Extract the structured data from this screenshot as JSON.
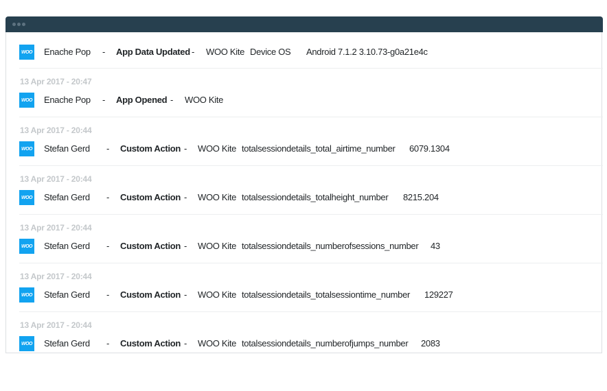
{
  "window": {
    "titlebar_dots": 3
  },
  "feed": {
    "entries": [
      {
        "timestamp": "",
        "app_icon": "woo-logo-icon",
        "app_icon_text": "WOO",
        "user": "Enache Pop",
        "separator1": "-",
        "event": "App Data Updated",
        "separator2": "-",
        "app": "WOO Kite",
        "property": "Device OS",
        "value": "Android 7.1.2 3.10.73-g0a21e4c"
      },
      {
        "timestamp": "13 Apr 2017 - 20:47",
        "app_icon": "woo-logo-icon",
        "app_icon_text": "WOO",
        "user": "Enache Pop",
        "separator1": "-",
        "event": "App Opened",
        "separator2": "-",
        "app": "WOO Kite",
        "property": "",
        "value": ""
      },
      {
        "timestamp": "13 Apr 2017 - 20:44",
        "app_icon": "woo-logo-icon",
        "app_icon_text": "WOO",
        "user": "Stefan Gerd",
        "separator1": "-",
        "event": "Custom Action",
        "separator2": "-",
        "app": "WOO Kite",
        "property": "totalsessiondetails_total_airtime_number",
        "value": "6079.1304"
      },
      {
        "timestamp": "13 Apr 2017 - 20:44",
        "app_icon": "woo-logo-icon",
        "app_icon_text": "WOO",
        "user": "Stefan Gerd",
        "separator1": "-",
        "event": "Custom Action",
        "separator2": "-",
        "app": "WOO Kite",
        "property": "totalsessiondetails_totalheight_number",
        "value": "8215.204"
      },
      {
        "timestamp": "13 Apr 2017 - 20:44",
        "app_icon": "woo-logo-icon",
        "app_icon_text": "WOO",
        "user": "Stefan Gerd",
        "separator1": "-",
        "event": "Custom Action",
        "separator2": "-",
        "app": "WOO Kite",
        "property": "totalsessiondetails_numberofsessions_number",
        "value": "43"
      },
      {
        "timestamp": "13 Apr 2017 - 20:44",
        "app_icon": "woo-logo-icon",
        "app_icon_text": "WOO",
        "user": "Stefan Gerd",
        "separator1": "-",
        "event": "Custom Action",
        "separator2": "-",
        "app": "WOO Kite",
        "property": "totalsessiondetails_totalsessiontime_number",
        "value": "129227"
      },
      {
        "timestamp": "13 Apr 2017 - 20:44",
        "app_icon": "woo-logo-icon",
        "app_icon_text": "WOO",
        "user": "Stefan Gerd",
        "separator1": "-",
        "event": "Custom Action",
        "separator2": "-",
        "app": "WOO Kite",
        "property": "totalsessiondetails_numberofjumps_number",
        "value": "2083"
      }
    ]
  },
  "colors": {
    "titlebar": "#27404f",
    "brand_blue": "#12a3f0",
    "timestamp_gray": "#c4c8cb",
    "text": "#1f2326"
  }
}
